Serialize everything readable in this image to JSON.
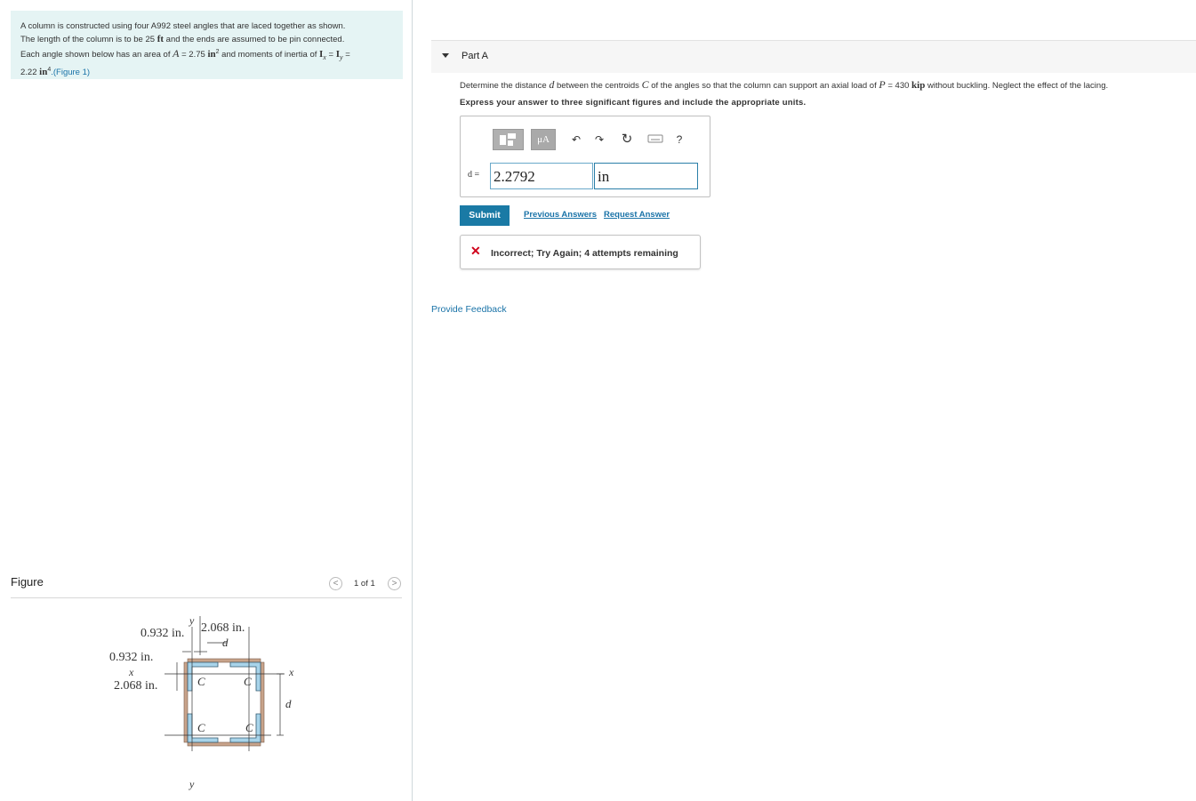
{
  "problem": {
    "line1": "A column is constructed using four A992 steel angles that are laced together as shown.",
    "line2a": "The length of the column is to be 25",
    "line2_unit": "ft",
    "line2b": "and the ends are assumed to be pin connected.",
    "line3a": "Each angle shown below has an area of",
    "line3_var": "A",
    "line3_eq": "= 2.75",
    "line3_unit": "in",
    "line3_sup": "2",
    "line3b": "and moments of inertia of",
    "line3_Ix": "I",
    "line3_Ix_sub": "x",
    "line3_eq2": "=",
    "line3_Iy": "I",
    "line3_Iy_sub": "y",
    "line3_eq3": "=",
    "line4_val": "2.22",
    "line4_unit": "in",
    "line4_sup": "4",
    "figure_link": ".(Figure 1)"
  },
  "figure": {
    "title": "Figure",
    "counter": "1 of 1",
    "prev": "<",
    "next": ">",
    "labels": {
      "y_top": "y",
      "dim_0932_top": "0.932 in.",
      "dim_2068_top": "2.068 in.",
      "d_top": "d",
      "dim_0932_left": "0.932 in.",
      "x_left": "x",
      "dim_2068_left": "2.068 in.",
      "C": "C",
      "x_right": "x",
      "d_right": "d",
      "y_bottom": "y"
    }
  },
  "part": {
    "title": "Part A",
    "question_a": "Determine the distance",
    "question_var_d": "d",
    "question_b": "between the centroids",
    "question_var_C": "C",
    "question_c": "of the angles so that the column can support an axial load of",
    "question_var_P": "P",
    "question_d": "= 430",
    "question_unit": "kip",
    "question_e": "without buckling. Neglect the effect of the lacing.",
    "instruction": "Express your answer to three significant figures and include the appropriate units."
  },
  "toolbar": {
    "mu_label": "μA",
    "undo": "↶",
    "redo": "↷",
    "reset": "↻",
    "help": "?",
    "icons": [
      "templates-icon",
      "units-icon",
      "undo-icon",
      "redo-icon",
      "reset-icon",
      "keyboard-icon",
      "help-icon"
    ]
  },
  "answer": {
    "label": "d =",
    "value": "2.2792",
    "units": "in"
  },
  "actions": {
    "submit": "Submit",
    "previous_answers": "Previous Answers",
    "request_answer": "Request Answer"
  },
  "feedback": {
    "icon": "✕",
    "text": "Incorrect; Try Again; 4 attempts remaining",
    "provide_feedback": "Provide Feedback"
  },
  "colors": {
    "problem_bg": "#e5f4f4",
    "submit_bg": "#1a7aa5",
    "link": "#1a73a8",
    "error": "#d0021b",
    "angle_blue": "#a8d4ea",
    "angle_brown": "#c8a38a"
  }
}
